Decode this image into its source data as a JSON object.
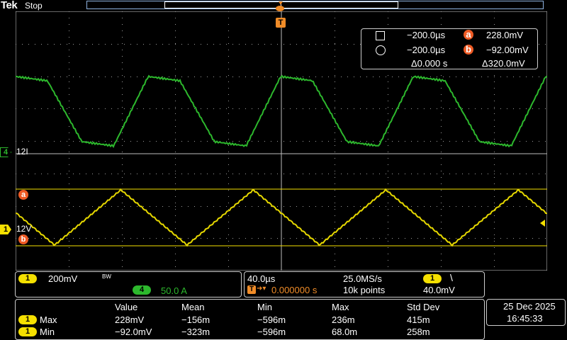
{
  "header": {
    "brand": "Tek",
    "run_state": "Stop"
  },
  "trigger_marker": "T",
  "cursor_readout": {
    "cursor1_time": "−200.0µs",
    "cursor1_label": "a",
    "cursor1_value": "228.0mV",
    "cursor2_time": "−200.0µs",
    "cursor2_label": "b",
    "cursor2_value": "−92.00mV",
    "delta_time": "Δ0.000 s",
    "delta_value": "Δ320.0mV"
  },
  "channel_markers": {
    "ch4_number": "4",
    "ch4_label": "12I",
    "ch1_number": "1",
    "ch1_label": "12V",
    "cursor_a": "a",
    "cursor_b": "b"
  },
  "vertical_panel": {
    "ch1_number": "1",
    "ch1_scale": "200mV",
    "ch1_bw": "BW",
    "ch4_number": "4",
    "ch4_scale": "50.0 A"
  },
  "horizontal_panel": {
    "time_scale": "40.0µs",
    "sample_rate": "25.0MS/s",
    "trigger_source": "1",
    "trigger_slope": "\\",
    "trigger_position": "0.000000 s",
    "record_length": "10k points",
    "trigger_level": "40.0mV",
    "trigger_prefix": "T"
  },
  "measurements": {
    "headers": [
      "Value",
      "Mean",
      "Min",
      "Max",
      "Std Dev"
    ],
    "rows": [
      {
        "ch": "1",
        "name": "Max",
        "values": [
          "228mV",
          "−156m",
          "−596m",
          "236m",
          "415m"
        ]
      },
      {
        "ch": "1",
        "name": "Min",
        "values": [
          "−92.0mV",
          "−323m",
          "−596m",
          "68.0m",
          "258m"
        ]
      }
    ]
  },
  "clock": {
    "date": "25 Dec  2025",
    "time": "16:45:33"
  },
  "colors": {
    "ch1": "#f5e000",
    "ch4": "#2db82d",
    "cursor": "#ee5a24",
    "trigger": "#f08c28",
    "grid": "#d0d0d0"
  }
}
